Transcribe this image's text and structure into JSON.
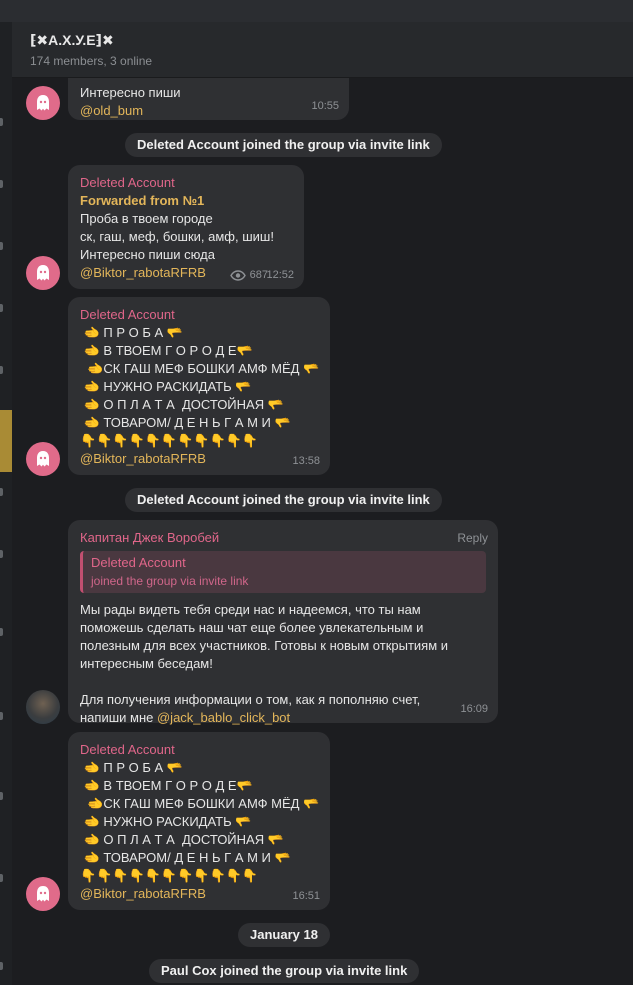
{
  "header": {
    "title": "⁅✖А.Х.У.Е⁆✖",
    "subtitle": "174 members, 3 online"
  },
  "messages": [
    {
      "lines": [
        "Интересно пиши"
      ],
      "link": "@old_bum",
      "time": "10:55"
    },
    {
      "sender": "Deleted Account",
      "forwarded": "Forwarded from №1",
      "lines": [
        "Проба в твоем городе",
        "ск, гаш, меф, бошки, амф, шиш!",
        "Интересно пиши сюда"
      ],
      "link": "@Biktor_rabotaRFRB",
      "views": "687",
      "time": "12:52"
    },
    {
      "sender": "Deleted Account",
      "lines": [
        " 🫲 П Р О Б А 🫳",
        " 🫲 В ТВОЕМ Г О Р О Д Е🫳",
        "  🫲СК ГАШ МЕФ БОШКИ АМФ МЁД 🫳",
        " 🫲 НУЖНО РАСКИДАТЬ 🫳",
        " 🫲 О П Л А Т А  ДОСТОЙНАЯ 🫳",
        " 🫲 ТОВАРОМ/ Д Е Н Ь Г А М И 🫳",
        "👇👇👇👇👇👇👇👇👇👇👇"
      ],
      "link": "@Biktor_rabotaRFRB",
      "time": "13:58"
    },
    {
      "sender": "Капитан Джек Воробей",
      "reply_label": "Reply",
      "quote_name": "Deleted Account",
      "quote_text": "joined the group via invite link",
      "lines": [
        "Мы рады видеть тебя среди нас и надеемся, что ты нам",
        "поможешь сделать наш чат еще более увлекательным и",
        "полезным для всех участников. Готовы к новым открытиям и",
        "интересным беседам!",
        "",
        "Для получения информации о том, как я пополняю счет,"
      ],
      "last_line_prefix": "напиши мне ",
      "link": "@jack_bablo_click_bot",
      "time": "16:09"
    },
    {
      "sender": "Deleted Account",
      "lines": [
        " 🫲 П Р О Б А 🫳",
        " 🫲 В ТВОЕМ Г О Р О Д Е🫳",
        "  🫲СК ГАШ МЕФ БОШКИ АМФ МЁД 🫳",
        " 🫲 НУЖНО РАСКИДАТЬ 🫳",
        " 🫲 О П Л А Т А  ДОСТОЙНАЯ 🫳",
        " 🫲 ТОВАРОМ/ Д Е Н Ь Г А М И 🫳",
        "👇👇👇👇👇👇👇👇👇👇👇"
      ],
      "link": "@Biktor_rabotaRFRB",
      "time": "16:51"
    }
  ],
  "service": {
    "join1": "Deleted Account joined the group via invite link",
    "join2": "Deleted Account joined the group via invite link",
    "date": "January 18",
    "join3": "Paul Cox joined the group via invite link"
  },
  "colors": {
    "sender": "#e0668a",
    "link": "#e3b65a",
    "bubble": "#2f3033",
    "sidebar_accent": "#a98b35"
  },
  "icons": {
    "avatar": "ghost-icon",
    "views": "eye-icon"
  }
}
